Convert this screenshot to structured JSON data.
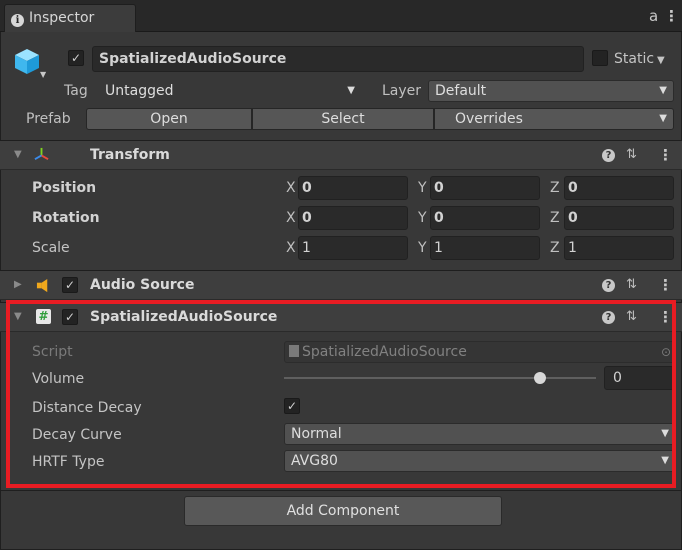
{
  "tab": {
    "title": "Inspector",
    "lock_glyph": "a",
    "menu_glyph": "⋮"
  },
  "gameobject": {
    "active": true,
    "name": "SpatializedAudioSource",
    "static_label": "Static",
    "tag_label": "Tag",
    "tag_value": "Untagged",
    "layer_label": "Layer",
    "layer_value": "Default",
    "prefab_label": "Prefab",
    "prefab_open": "Open",
    "prefab_select": "Select",
    "prefab_overrides": "Overrides"
  },
  "transform": {
    "title": "Transform",
    "rows": [
      {
        "label": "Position",
        "x": "0",
        "y": "0",
        "z": "0"
      },
      {
        "label": "Rotation",
        "x": "0",
        "y": "0",
        "z": "0"
      },
      {
        "label": "Scale",
        "x": "1",
        "y": "1",
        "z": "1"
      }
    ],
    "axes": {
      "x": "X",
      "y": "Y",
      "z": "Z"
    }
  },
  "audio_source": {
    "title": "Audio Source",
    "enabled": true
  },
  "spatialized": {
    "title": "SpatializedAudioSource",
    "enabled": true,
    "script_label": "Script",
    "script_value": "SpatializedAudioSource",
    "volume_label": "Volume",
    "volume_value": "0",
    "volume_fraction": 0.82,
    "distance_decay_label": "Distance Decay",
    "distance_decay_checked": true,
    "decay_curve_label": "Decay Curve",
    "decay_curve_value": "Normal",
    "hrtf_label": "HRTF Type",
    "hrtf_value": "AVG80"
  },
  "add_component": "Add Component",
  "colors": {
    "highlight": "#e81c23",
    "audio_icon": "#f0a81c"
  }
}
